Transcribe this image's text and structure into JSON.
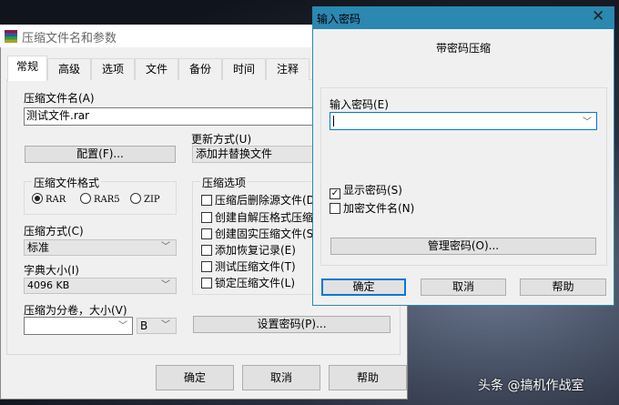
{
  "main_dialog": {
    "title": "压缩文件名和参数",
    "tabs": [
      "常规",
      "高级",
      "选项",
      "文件",
      "备份",
      "时间",
      "注释"
    ],
    "archive_name_label": "压缩文件名(A)",
    "archive_name_value": "测试文件.rar",
    "profiles_button": "配置(F)...",
    "update_mode_label": "更新方式(U)",
    "update_mode_value": "添加并替换文件",
    "format_group": "压缩文件格式",
    "formats": [
      {
        "label": "RAR",
        "selected": true
      },
      {
        "label": "RAR5",
        "selected": false
      },
      {
        "label": "ZIP",
        "selected": false
      }
    ],
    "method_label": "压缩方式(C)",
    "method_value": "标准",
    "dict_label": "字典大小(I)",
    "dict_value": "4096 KB",
    "split_label": "压缩为分卷，大小(V)",
    "split_value": "",
    "split_unit": "B",
    "options_group": "压缩选项",
    "options": [
      {
        "label": "压缩后删除源文件(D)",
        "checked": false
      },
      {
        "label": "创建自解压格式压缩文件(X)",
        "checked": false
      },
      {
        "label": "创建固实压缩文件(S)",
        "checked": false
      },
      {
        "label": "添加恢复记录(E)",
        "checked": false
      },
      {
        "label": "测试压缩文件(T)",
        "checked": false
      },
      {
        "label": "锁定压缩文件(L)",
        "checked": false
      }
    ],
    "set_password_button": "设置密码(P)...",
    "ok": "确定",
    "cancel": "取消",
    "help": "帮助"
  },
  "password_dialog": {
    "title": "输入密码",
    "heading": "带密码压缩",
    "password_label": "输入密码(E)",
    "password_value": "",
    "show_password": {
      "label": "显示密码(S)",
      "checked": true
    },
    "encrypt_names": {
      "label": "加密文件名(N)",
      "checked": false
    },
    "manage_button": "管理密码(O)...",
    "ok": "确定",
    "cancel": "取消",
    "help": "帮助",
    "title_bar_color": "#2b88b0"
  },
  "watermark": "头条 @搞机作战室"
}
